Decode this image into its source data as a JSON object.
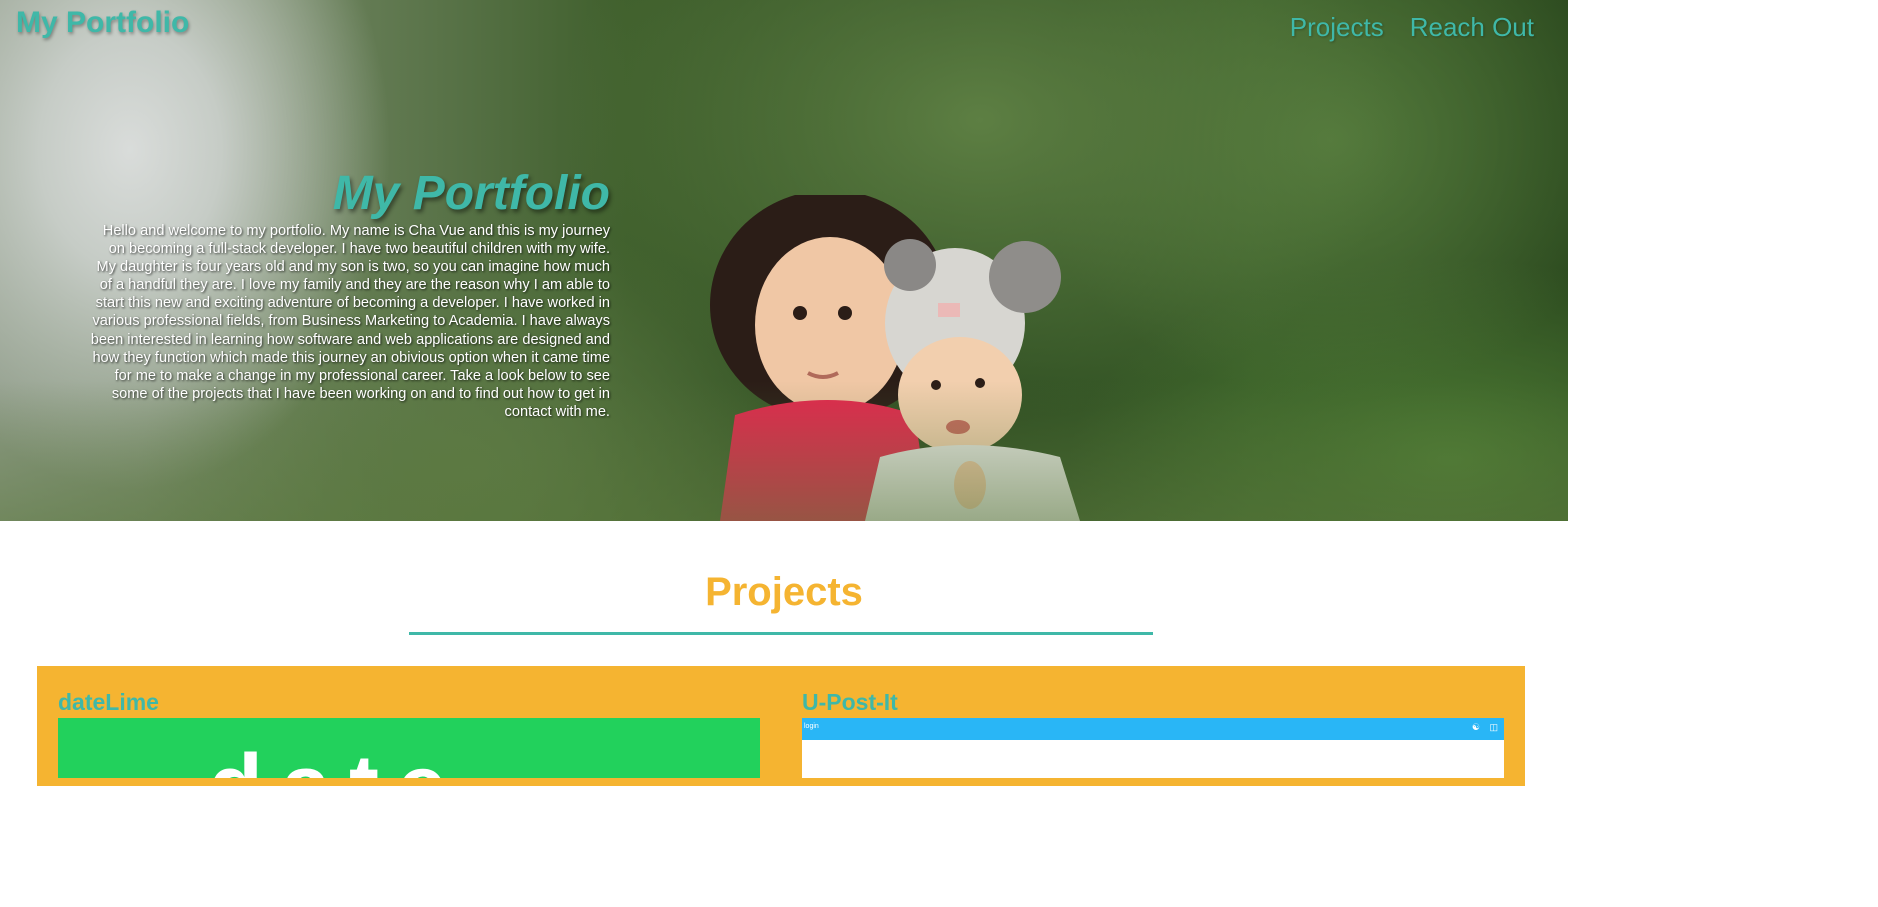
{
  "nav": {
    "brand": "My Portfolio",
    "links": [
      "Projects",
      "Reach Out"
    ]
  },
  "hero": {
    "title": "My Portfolio",
    "bio": "Hello and welcome to my portfolio. My name is Cha Vue and this is my journey on becoming a full-stack developer. I have two beautiful children with my wife. My daughter is four years old and my son is two, so you can imagine how much of a handful they are. I love my family and they are the reason why I am able to start this new and exciting adventure of becoming a developer. I have worked in various professional fields, from Business Marketing to Academia. I have always been interested in learning how software and web applications are designed and how they function which made this journey an obivious option when it came time for me to make a change in my professional career. Take a look below to see some of the projects that I have been working on and to find out how to get in contact with me."
  },
  "projects": {
    "heading": "Projects",
    "items": [
      {
        "name": "dateLime",
        "thumb_text": "date"
      },
      {
        "name": "U-Post-It",
        "thumb_bar_label": "login"
      }
    ]
  },
  "colors": {
    "accent_teal": "#3fb8a8",
    "accent_gold": "#f5b431",
    "datelime_green": "#22d15c",
    "upost_blue": "#29b6f6"
  },
  "icons": [
    "user-icon",
    "trash-icon"
  ]
}
